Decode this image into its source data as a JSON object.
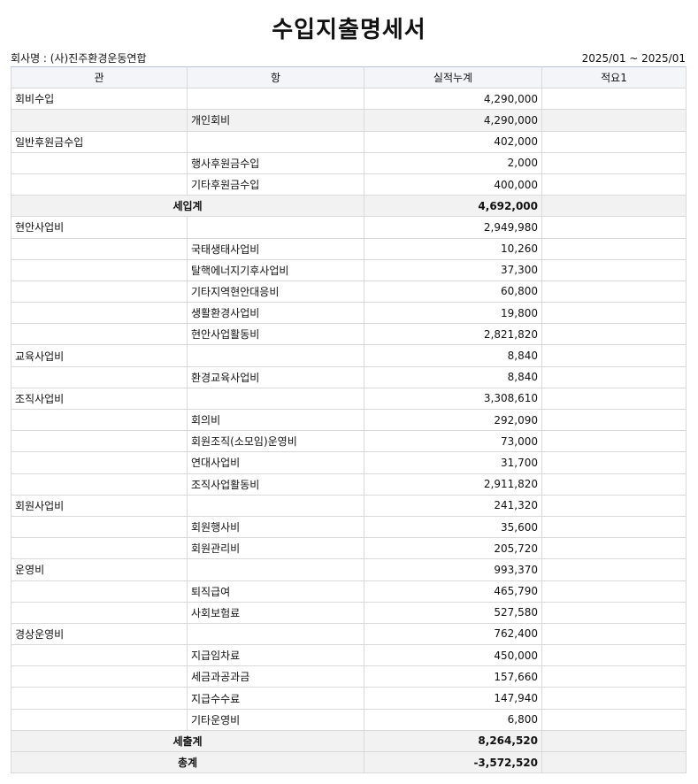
{
  "title": "수입지출명세서",
  "company": "회사명 : (사)진주환경운동연합",
  "period": "2025/01 ~ 2025/01",
  "columns": [
    "관",
    "항",
    "실적누계",
    "적요1"
  ],
  "rows": [
    {
      "type": "gwan",
      "gwan": "회비수입",
      "hang": "",
      "amount": "4,290,000",
      "note": ""
    },
    {
      "type": "hang",
      "gwan": "",
      "hang": "개인회비",
      "amount": "4,290,000",
      "note": "",
      "shade": true
    },
    {
      "type": "gwan",
      "gwan": "일반후원금수입",
      "hang": "",
      "amount": "402,000",
      "note": ""
    },
    {
      "type": "hang",
      "gwan": "",
      "hang": "행사후원금수입",
      "amount": "2,000",
      "note": ""
    },
    {
      "type": "hang",
      "gwan": "",
      "hang": "기타후원금수입",
      "amount": "400,000",
      "note": ""
    },
    {
      "type": "total",
      "label": "세입계",
      "amount": "4,692,000",
      "note": ""
    },
    {
      "type": "gwan",
      "gwan": "현안사업비",
      "hang": "",
      "amount": "2,949,980",
      "note": ""
    },
    {
      "type": "hang",
      "gwan": "",
      "hang": "국태생태사업비",
      "amount": "10,260",
      "note": ""
    },
    {
      "type": "hang",
      "gwan": "",
      "hang": "탈핵에너지기후사업비",
      "amount": "37,300",
      "note": ""
    },
    {
      "type": "hang",
      "gwan": "",
      "hang": "기타지역현안대응비",
      "amount": "60,800",
      "note": ""
    },
    {
      "type": "hang",
      "gwan": "",
      "hang": "생활환경사업비",
      "amount": "19,800",
      "note": ""
    },
    {
      "type": "hang",
      "gwan": "",
      "hang": "현안사업활동비",
      "amount": "2,821,820",
      "note": ""
    },
    {
      "type": "gwan",
      "gwan": "교육사업비",
      "hang": "",
      "amount": "8,840",
      "note": ""
    },
    {
      "type": "hang",
      "gwan": "",
      "hang": "환경교육사업비",
      "amount": "8,840",
      "note": ""
    },
    {
      "type": "gwan",
      "gwan": "조직사업비",
      "hang": "",
      "amount": "3,308,610",
      "note": ""
    },
    {
      "type": "hang",
      "gwan": "",
      "hang": "회의비",
      "amount": "292,090",
      "note": ""
    },
    {
      "type": "hang",
      "gwan": "",
      "hang": "회원조직(소모임)운영비",
      "amount": "73,000",
      "note": ""
    },
    {
      "type": "hang",
      "gwan": "",
      "hang": "연대사업비",
      "amount": "31,700",
      "note": ""
    },
    {
      "type": "hang",
      "gwan": "",
      "hang": "조직사업활동비",
      "amount": "2,911,820",
      "note": ""
    },
    {
      "type": "gwan",
      "gwan": "회원사업비",
      "hang": "",
      "amount": "241,320",
      "note": ""
    },
    {
      "type": "hang",
      "gwan": "",
      "hang": "회원행사비",
      "amount": "35,600",
      "note": ""
    },
    {
      "type": "hang",
      "gwan": "",
      "hang": "회원관리비",
      "amount": "205,720",
      "note": ""
    },
    {
      "type": "gwan",
      "gwan": "운영비",
      "hang": "",
      "amount": "993,370",
      "note": ""
    },
    {
      "type": "hang",
      "gwan": "",
      "hang": "퇴직급여",
      "amount": "465,790",
      "note": ""
    },
    {
      "type": "hang",
      "gwan": "",
      "hang": "사회보험료",
      "amount": "527,580",
      "note": ""
    },
    {
      "type": "gwan",
      "gwan": "경상운영비",
      "hang": "",
      "amount": "762,400",
      "note": ""
    },
    {
      "type": "hang",
      "gwan": "",
      "hang": "지급임차료",
      "amount": "450,000",
      "note": ""
    },
    {
      "type": "hang",
      "gwan": "",
      "hang": "세금과공과금",
      "amount": "157,660",
      "note": ""
    },
    {
      "type": "hang",
      "gwan": "",
      "hang": "지급수수료",
      "amount": "147,940",
      "note": ""
    },
    {
      "type": "hang",
      "gwan": "",
      "hang": "기타운영비",
      "amount": "6,800",
      "note": ""
    },
    {
      "type": "total",
      "label": "세출계",
      "amount": "8,264,520",
      "note": ""
    },
    {
      "type": "total",
      "label": "총계",
      "amount": "-3,572,520",
      "note": ""
    }
  ]
}
